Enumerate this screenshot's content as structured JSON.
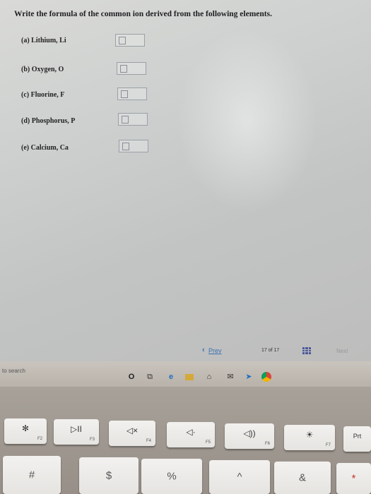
{
  "question": "Write the formula of the common ion derived from the following elements.",
  "items": [
    {
      "label": "(a) Lithium, Li"
    },
    {
      "label": "(b) Oxygen, O"
    },
    {
      "label": "(c) Fluorine, F"
    },
    {
      "label": "(d) Phosphorus, P"
    },
    {
      "label": "(e) Calcium, Ca"
    }
  ],
  "pager": {
    "prev": "Prev",
    "count": "17 of 17",
    "next": "Next"
  },
  "taskbar": {
    "search_placeholder": "to search",
    "icons": [
      "cortana-icon",
      "task-view-icon",
      "edge-icon",
      "file-explorer-icon",
      "store-icon",
      "mail-icon",
      "chrome-icon"
    ]
  },
  "keyboard": {
    "fn_row": [
      {
        "symbol": "✻",
        "fn": "F2"
      },
      {
        "symbol": "▷II",
        "fn": "F3"
      },
      {
        "symbol": "◁×",
        "fn": "F4"
      },
      {
        "symbol": "◁·",
        "fn": "F5"
      },
      {
        "symbol": "◁))",
        "fn": "F6"
      },
      {
        "symbol": "☀",
        "fn": "F7"
      },
      {
        "symbol": "Prt",
        "fn": ""
      }
    ],
    "num_row": [
      "#",
      "$",
      "%",
      "^",
      "&",
      "*"
    ]
  }
}
